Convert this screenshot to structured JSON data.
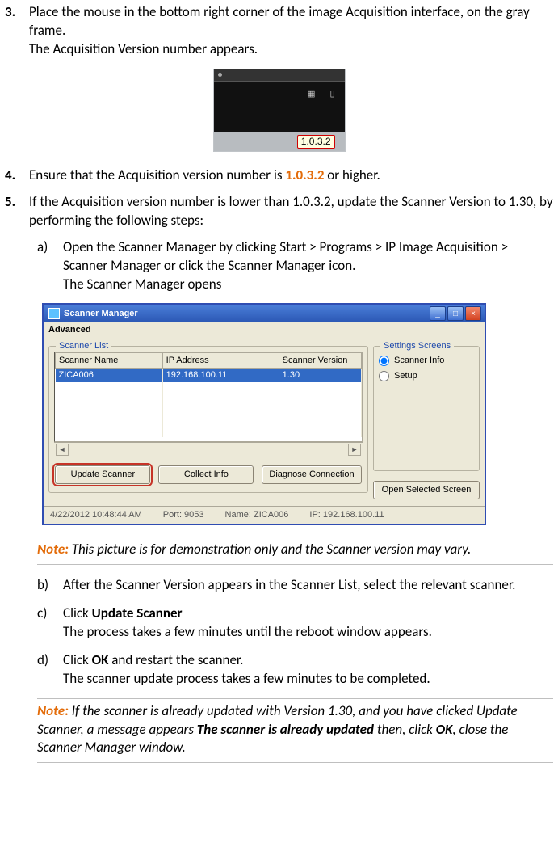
{
  "steps": {
    "s3": {
      "num": "3.",
      "line1": "Place the mouse in the bottom right corner of the image Acquisition interface, on the gray frame.",
      "line2": "The Acquisition Version number appears."
    },
    "fig1_version": "1.0.3.2",
    "s4": {
      "num": "4.",
      "pre": "Ensure that the Acquisition version number is ",
      "ver": "1.0.3.2",
      "post": " or higher."
    },
    "s5": {
      "num": "5.",
      "text": "If the Acquisition version number is lower than 1.0.3.2, update the Scanner Version to 1.30, by performing the following steps:"
    },
    "sub_a": {
      "letter": "a)",
      "l1": "Open the Scanner Manager by clicking Start > Programs > IP Image Acquisition > Scanner Manager or click the Scanner Manager icon.",
      "l2": "The Scanner Manager opens"
    },
    "note1": {
      "label": "Note:",
      "text": " This picture is for demonstration only and the Scanner version may vary."
    },
    "sub_b": {
      "letter": "b)",
      "text": "After the Scanner Version appears in the Scanner List, select the relevant scanner."
    },
    "sub_c": {
      "letter": "c)",
      "l1a": "Click ",
      "l1b": "Update Scanner",
      "l2": "The process takes a few minutes until the reboot window appears."
    },
    "sub_d": {
      "letter": "d)",
      "l1a": "Click ",
      "l1b": "OK",
      "l1c": " and restart the scanner.",
      "l2": "The scanner update process takes a few minutes to be completed."
    },
    "note2": {
      "label": "Note:",
      "t1": " If the scanner is already updated with Version 1.30, and you have clicked Update Scanner, a message appears ",
      "t2": "The scanner is already updated",
      "t3": " then, click ",
      "t4": "OK",
      "t5": ", close the Scanner Manager window."
    }
  },
  "sm": {
    "title": "Scanner Manager",
    "menu": "Advanced",
    "legend_left": "Scanner List",
    "legend_right": "Settings Screens",
    "cols": {
      "c1": "Scanner Name",
      "c2": "IP Address",
      "c3": "Scanner Version"
    },
    "row": {
      "c1": "ZICA006",
      "c2": "192.168.100.11",
      "c3": "1.30"
    },
    "buttons": {
      "b1": "Update Scanner",
      "b2": "Collect Info",
      "b3": "Diagnose Connection",
      "b4": "Open Selected Screen"
    },
    "radios": {
      "r1": "Scanner Info",
      "r2": "Setup"
    },
    "status": {
      "date": "4/22/2012 10:48:44 AM",
      "port": "Port: 9053",
      "name": "Name: ZICA006",
      "ip": "IP: 192.168.100.11"
    }
  }
}
